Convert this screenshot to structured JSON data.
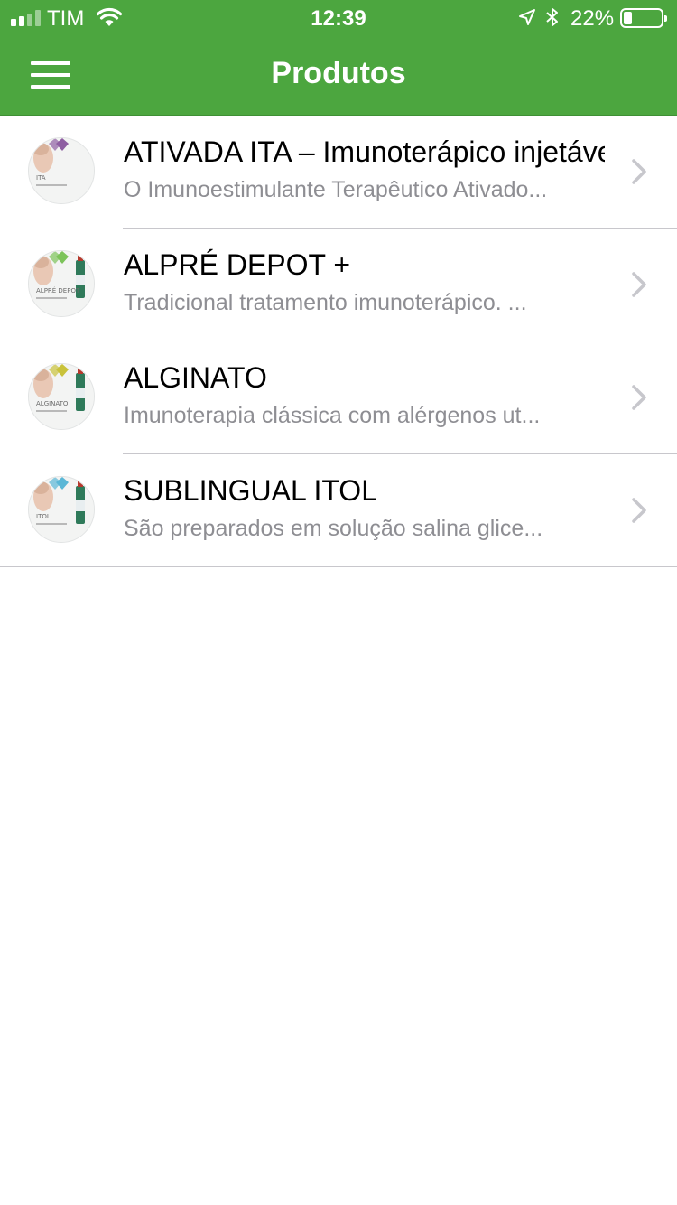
{
  "status_bar": {
    "carrier": "TIM",
    "time": "12:39",
    "battery_percent": "22%",
    "battery_level": 0.22,
    "signal_bars": 2,
    "icons": [
      "signal-icon",
      "wifi-icon",
      "location-arrow-icon",
      "bluetooth-icon",
      "battery-icon"
    ]
  },
  "nav": {
    "title": "Produtos",
    "menu_icon": "hamburger-menu-icon"
  },
  "colors": {
    "brand_green": "#4ca63f",
    "title_text": "#000000",
    "subtitle_text": "#8e8e93",
    "separator": "#c8c7cc",
    "chevron": "#c7c7cc"
  },
  "products": [
    {
      "title": "ATIVADA ITA – Imunoterápico injetável",
      "subtitle": "O Imunoestimulante Terapêutico Ativado...",
      "thumb_label": "ITA",
      "accent": "#8e5ea2"
    },
    {
      "title": "ALPRÉ DEPOT +",
      "subtitle": "Tradicional tratamento imunoterápico. ...",
      "thumb_label": "ALPRÉ DEPOT",
      "accent": "#7cc35a"
    },
    {
      "title": "ALGINATO",
      "subtitle": "Imunoterapia clássica com alérgenos ut...",
      "thumb_label": "ALGINATO",
      "accent": "#c9c23a"
    },
    {
      "title": "SUBLINGUAL ITOL",
      "subtitle": "São preparados em solução salina glice...",
      "thumb_label": "ITOL",
      "accent": "#5ab7d6"
    }
  ]
}
